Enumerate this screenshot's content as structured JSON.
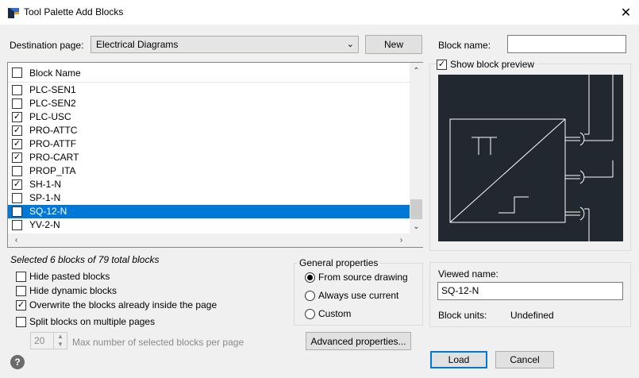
{
  "window": {
    "title": "Tool Palette Add Blocks",
    "close_glyph": "✕"
  },
  "destination": {
    "label": "Destination page:",
    "value": "Electrical Diagrams",
    "new_button": "New"
  },
  "block_list": {
    "header": "Block Name",
    "rows": [
      {
        "name": "PLC-SEN1",
        "checked": false,
        "selected": false
      },
      {
        "name": "PLC-SEN2",
        "checked": false,
        "selected": false
      },
      {
        "name": "PLC-USC",
        "checked": true,
        "selected": false
      },
      {
        "name": "PRO-ATTC",
        "checked": true,
        "selected": false
      },
      {
        "name": "PRO-ATTF",
        "checked": true,
        "selected": false
      },
      {
        "name": "PRO-CART",
        "checked": true,
        "selected": false
      },
      {
        "name": "PROP_ITA",
        "checked": false,
        "selected": false
      },
      {
        "name": "SH-1-N",
        "checked": true,
        "selected": false
      },
      {
        "name": "SP-1-N",
        "checked": false,
        "selected": false
      },
      {
        "name": "SQ-12-N",
        "checked": true,
        "selected": true
      },
      {
        "name": "YV-2-N",
        "checked": false,
        "selected": false
      }
    ]
  },
  "status": "Selected 6 blocks of 79 total blocks",
  "options": {
    "hide_pasted": {
      "label": "Hide pasted blocks",
      "checked": false
    },
    "hide_dynamic": {
      "label": "Hide dynamic blocks",
      "checked": false
    },
    "overwrite": {
      "label": "Overwrite the blocks already inside the page",
      "checked": true
    },
    "split": {
      "label": "Split blocks on multiple pages",
      "checked": false
    },
    "max_value": "20",
    "max_label": "Max number of selected blocks per page"
  },
  "general_properties": {
    "title": "General properties",
    "radios": [
      {
        "label": "From source drawing",
        "selected": true
      },
      {
        "label": "Always use current",
        "selected": false
      },
      {
        "label": "Custom",
        "selected": false
      }
    ],
    "advanced_button": "Advanced properties..."
  },
  "right_panel": {
    "block_name_label": "Block name:",
    "block_name_value": "",
    "show_preview_label": "Show block preview",
    "show_preview_checked": true,
    "viewed_name_label": "Viewed name:",
    "viewed_name_value": "SQ-12-N",
    "block_units_label": "Block units:",
    "block_units_value": "Undefined"
  },
  "buttons": {
    "load": "Load",
    "cancel": "Cancel"
  },
  "colors": {
    "selection": "#0078d7",
    "preview_bg": "#212830",
    "preview_stroke": "#ffffff"
  }
}
